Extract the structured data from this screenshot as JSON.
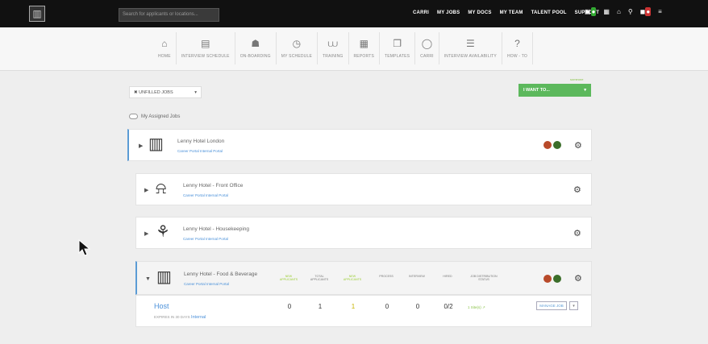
{
  "topbar": {
    "search_placeholder": "Search for applicants or locations...",
    "links": [
      "CARRI",
      "MY JOBS",
      "MY DOCS",
      "MY TEAM",
      "TALENT POOL",
      "SUPPORT"
    ]
  },
  "nav": {
    "items": [
      {
        "label": "HOME",
        "icon": "home-icon",
        "glyph": "⌂"
      },
      {
        "label": "INTERVIEW SCHEDULE",
        "icon": "calendar-icon",
        "glyph": "▤"
      },
      {
        "label": "ON-BOARDING",
        "icon": "people-icon",
        "glyph": "☗"
      },
      {
        "label": "MY SCHEDULE",
        "icon": "clock-icon",
        "glyph": "◷"
      },
      {
        "label": "TRAINING",
        "icon": "graduation-cap-icon",
        "glyph": "⩊"
      },
      {
        "label": "REPORTS",
        "icon": "chart-icon",
        "glyph": "▦"
      },
      {
        "label": "TEMPLATES",
        "icon": "copy-icon",
        "glyph": "❐"
      },
      {
        "label": "CARRI",
        "icon": "chat-icon",
        "glyph": "◯"
      },
      {
        "label": "INTERVIEW AVAILABILITY",
        "icon": "grid-icon",
        "glyph": "☰"
      },
      {
        "label": "HOW - TO",
        "icon": "help-icon",
        "glyph": "?"
      }
    ]
  },
  "filter": {
    "label": "✖ UNFILLED JOBS",
    "caret": "▾"
  },
  "assigned_label": "My Assigned Jobs",
  "iwant": {
    "hint": "someone",
    "label": "I WANT TO...",
    "caret": "▾"
  },
  "locations": [
    {
      "name": "Lenny Hotel London"
    },
    {
      "name": "Lenny Hotel - Front Office"
    },
    {
      "name": "Lenny Hotel - Housekeeping"
    },
    {
      "name": "Lenny Hotel - Food & Beverage"
    }
  ],
  "portal_links": {
    "career": "Career Portal",
    "internal": "Internal Portal"
  },
  "columns": [
    "NEW APPLICANTS",
    "TOTAL APPLICANTS",
    "NEW APPLICANTS",
    "PROCESS",
    "INTERVIEW",
    "HIRED",
    "JOB DISTRIBUTION STATUS"
  ],
  "job": {
    "title": "Host",
    "subtitle": "EXPIRES IN 30 DAYS",
    "visibility": "Internal",
    "values": [
      "0",
      "1",
      "1",
      "0",
      "0",
      "0/2"
    ],
    "distribution": "1 Site(s) ↗",
    "manage_label": "MANAGE JOB",
    "manage_caret": "▾"
  },
  "colors": {
    "accent_blue": "#4a90d9",
    "green": "#5cb85c",
    "topbar": "#111111"
  }
}
